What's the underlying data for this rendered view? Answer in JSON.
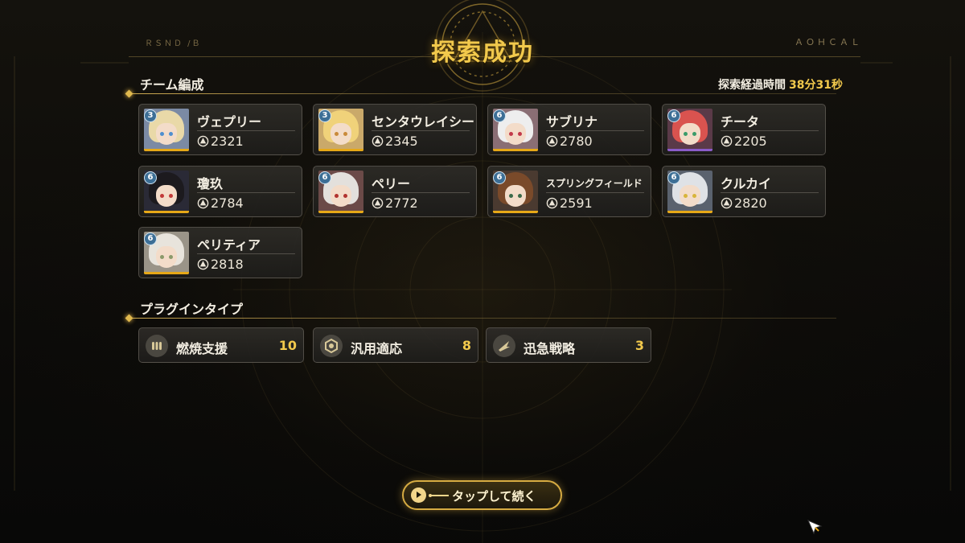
{
  "header": {
    "title": "探索成功",
    "deco_left": "ＲＳＮＤ /Ｂ",
    "deco_right": "ＡＯＨＣＡＬ"
  },
  "team": {
    "title": "チーム編成",
    "time_label": "探索経過時間",
    "time_value": "38分31秒",
    "members": [
      {
        "name": "ヴェプリー",
        "level": "3",
        "power": "2321",
        "bar_color": "#e6a817",
        "hair": "#e9d9a8",
        "eye": "#4f8fcf",
        "bg": "#7b8aa4"
      },
      {
        "name": "センタウレイシー",
        "level": "3",
        "power": "2345",
        "bar_color": "#e6a817",
        "hair": "#f0d27a",
        "eye": "#c98a3a",
        "bg": "#caa96a"
      },
      {
        "name": "サブリナ",
        "level": "6",
        "power": "2780",
        "bar_color": "#e6a817",
        "hair": "#eeeeee",
        "eye": "#c23a4a",
        "bg": "#8a6e74"
      },
      {
        "name": "チータ",
        "level": "6",
        "power": "2205",
        "bar_color": "#8a5cc9",
        "hair": "#d9534f",
        "eye": "#3a9c6a",
        "bg": "#5a3a48"
      },
      {
        "name": "瓊玖",
        "level": "6",
        "power": "2784",
        "bar_color": "#e6a817",
        "hair": "#1c1a1e",
        "eye": "#c23a3a",
        "bg": "#2a2a36"
      },
      {
        "name": "ペリー",
        "level": "6",
        "power": "2772",
        "bar_color": "#e6a817",
        "hair": "#e3e0dc",
        "eye": "#b2332f",
        "bg": "#6b4a48"
      },
      {
        "name": "スプリングフィールド",
        "level": "6",
        "power": "2591",
        "bar_color": "#e6a817",
        "hair": "#7a4a2a",
        "eye": "#3a6a4a",
        "bg": "#4a3a30"
      },
      {
        "name": "クルカイ",
        "level": "6",
        "power": "2820",
        "bar_color": "#e6a817",
        "hair": "#dfe2e6",
        "eye": "#d8b43a",
        "bg": "#5a626e"
      },
      {
        "name": "ペリティア",
        "level": "6",
        "power": "2818",
        "bar_color": "#e6a817",
        "hair": "#e8e4dc",
        "eye": "#8a9a6a",
        "bg": "#9a9488"
      }
    ]
  },
  "plugins": {
    "title": "プラグインタイプ",
    "items": [
      {
        "label": "燃焼支援",
        "count": "10",
        "icon": "ammo-icon"
      },
      {
        "label": "汎用適応",
        "count": "8",
        "icon": "hexagon-icon"
      },
      {
        "label": "迅急戦略",
        "count": "3",
        "icon": "wing-icon"
      }
    ]
  },
  "continue_button": {
    "label": "タップして続く"
  },
  "colors": {
    "accent": "#f2c94c",
    "card_bg": "#2a2825",
    "badge": "#3d6f96"
  }
}
